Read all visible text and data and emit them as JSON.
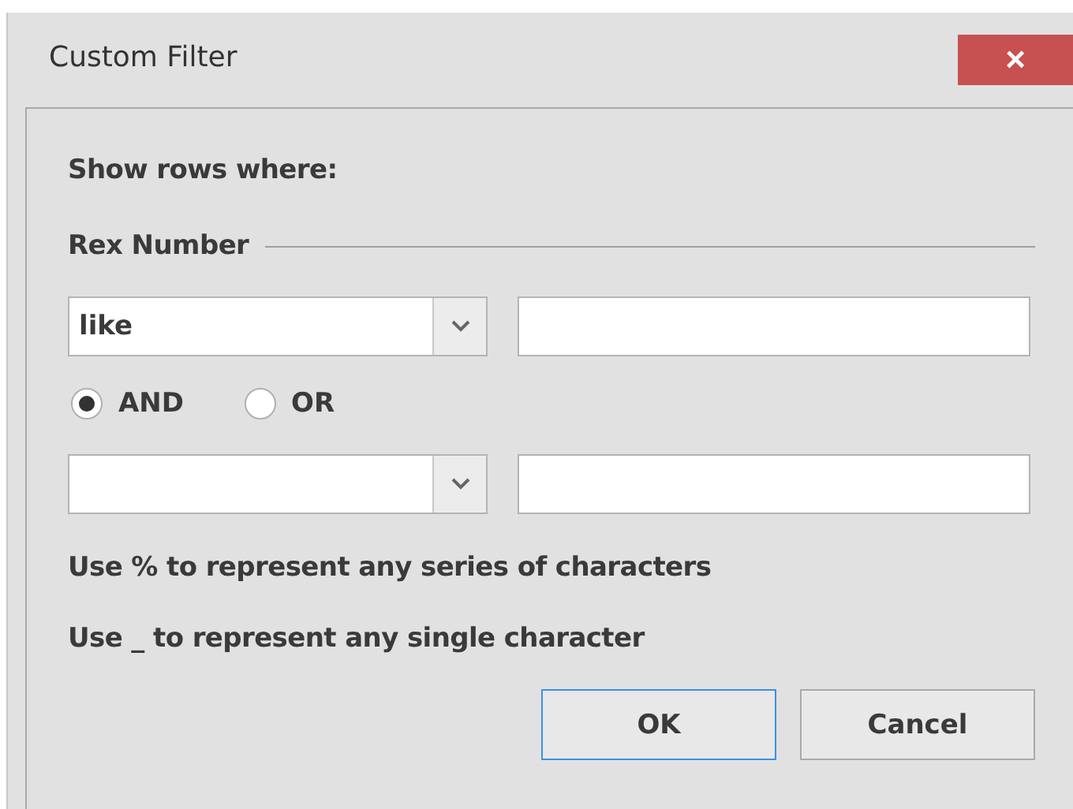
{
  "window": {
    "title": "Custom Filter",
    "close": "×"
  },
  "heading": "Show rows where:",
  "group": "Rex Number",
  "rows": [
    {
      "kind": "condition",
      "operator": "like"
    },
    {
      "kind": "join",
      "options": [
        {
          "label": "AND",
          "selected": true
        },
        {
          "label": "OR",
          "selected": false
        }
      ]
    },
    {
      "kind": "condition"
    }
  ],
  "hints": [
    "Use % to represent any series of characters",
    "Use _ to represent any single character"
  ],
  "buttons": [
    {
      "label": "OK",
      "default": true
    },
    {
      "label": "Cancel",
      "default": false
    }
  ]
}
